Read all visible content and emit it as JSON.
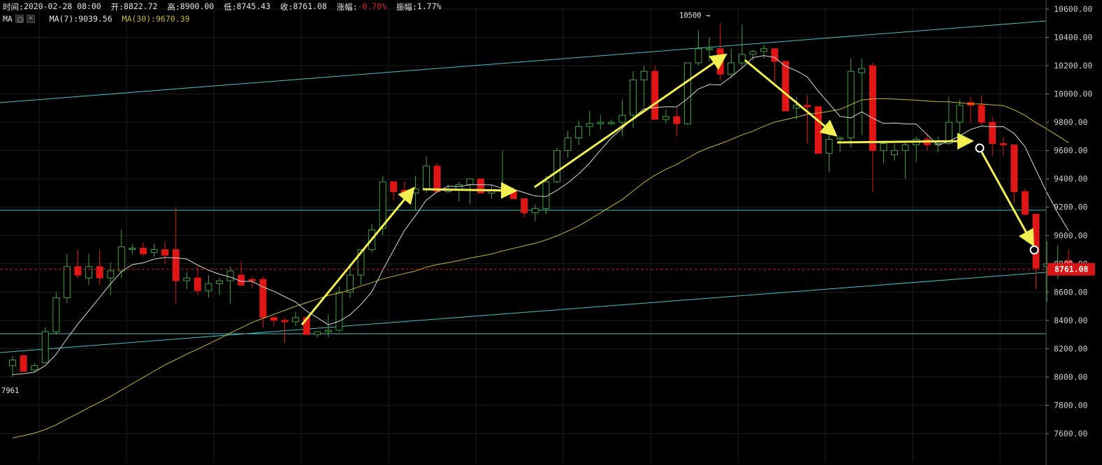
{
  "header": {
    "time_label": "时间:",
    "time_value": "2020-02-28 08:00",
    "open_label": "开:",
    "open_value": "8822.72",
    "high_label": "高:",
    "high_value": "8900.00",
    "low_label": "低:",
    "low_value": "8745.43",
    "close_label": "收:",
    "close_value": "8761.08",
    "change_label": "涨幅:",
    "change_value": "-0.70%",
    "amplitude_label": "振幅:",
    "amplitude_value": "1.77%"
  },
  "indicators": {
    "name": "MA",
    "ma7_label": "MA(7):",
    "ma7_value": "9039.56",
    "ma30_label": "MA(30):",
    "ma30_value": "9670.39"
  },
  "colors": {
    "up": "#3fa33f",
    "down": "#e01616",
    "ma7": "#d8d8d8",
    "ma30": "#c9b92a",
    "trendline": "#3fc4c4",
    "arrow": "#f2ef50",
    "grid": "#1d1d1d",
    "price_badge": "#d81414",
    "change_negative": "#e02424"
  },
  "chart_data": {
    "type": "candlestick",
    "y_ticks": [
      "10600.00",
      "10400.00",
      "10200.00",
      "10000.00",
      "9800.00",
      "9600.00",
      "9400.00",
      "9200.00",
      "9000.00",
      "8800.00",
      "8600.00",
      "8400.00",
      "8200.00",
      "8000.00",
      "7800.00",
      "7600.00"
    ],
    "ylim": [
      7500,
      10640
    ],
    "last_price_label": "8761.08",
    "last_price": 8761.08,
    "high_marker_label": "10500",
    "high_marker_value": 10500,
    "low_marker_label": "7961",
    "low_marker_value": 7961,
    "candles": [
      [
        8080,
        8150,
        8000,
        8120
      ],
      [
        8150,
        8160,
        8040,
        8040
      ],
      [
        8050,
        8100,
        8040,
        8080
      ],
      [
        8100,
        8350,
        8100,
        8320
      ],
      [
        8320,
        8600,
        8300,
        8560
      ],
      [
        8560,
        8870,
        8520,
        8780
      ],
      [
        8780,
        8900,
        8700,
        8720
      ],
      [
        8700,
        8870,
        8650,
        8780
      ],
      [
        8780,
        8900,
        8650,
        8700
      ],
      [
        8700,
        8810,
        8580,
        8750
      ],
      [
        8750,
        9040,
        8700,
        8920
      ],
      [
        8900,
        8940,
        8870,
        8910
      ],
      [
        8910,
        8950,
        8850,
        8870
      ],
      [
        8880,
        8940,
        8850,
        8900
      ],
      [
        8900,
        8960,
        8800,
        8860
      ],
      [
        8900,
        9200,
        8520,
        8680
      ],
      [
        8680,
        8740,
        8620,
        8700
      ],
      [
        8700,
        8780,
        8580,
        8610
      ],
      [
        8610,
        8720,
        8560,
        8660
      ],
      [
        8660,
        8700,
        8580,
        8680
      ],
      [
        8680,
        8780,
        8520,
        8750
      ],
      [
        8720,
        8820,
        8640,
        8650
      ],
      [
        8690,
        8710,
        8630,
        8680
      ],
      [
        8690,
        8710,
        8350,
        8420
      ],
      [
        8420,
        8430,
        8360,
        8400
      ],
      [
        8400,
        8420,
        8240,
        8390
      ],
      [
        8390,
        8460,
        8360,
        8420
      ],
      [
        8420,
        8420,
        8300,
        8300
      ],
      [
        8300,
        8320,
        8280,
        8320
      ],
      [
        8320,
        8440,
        8280,
        8330
      ],
      [
        8330,
        8640,
        8320,
        8600
      ],
      [
        8600,
        8780,
        8560,
        8720
      ],
      [
        8720,
        8850,
        8650,
        8900
      ],
      [
        8900,
        9080,
        8880,
        9040
      ],
      [
        9050,
        9420,
        9000,
        9380
      ],
      [
        9380,
        9380,
        9250,
        9310
      ],
      [
        9320,
        9380,
        9250,
        9300
      ],
      [
        9300,
        9420,
        9180,
        9330
      ],
      [
        9330,
        9560,
        9300,
        9490
      ],
      [
        9490,
        9510,
        9300,
        9310
      ],
      [
        9310,
        9360,
        9300,
        9320
      ],
      [
        9320,
        9380,
        9240,
        9360
      ],
      [
        9360,
        9400,
        9220,
        9400
      ],
      [
        9400,
        9400,
        9300,
        9300
      ],
      [
        9300,
        9360,
        9260,
        9320
      ],
      [
        9320,
        9600,
        9280,
        9320
      ],
      [
        9320,
        9340,
        9280,
        9260
      ],
      [
        9260,
        9250,
        9130,
        9160
      ],
      [
        9160,
        9220,
        9100,
        9190
      ],
      [
        9190,
        9420,
        9150,
        9380
      ],
      [
        9380,
        9620,
        9370,
        9600
      ],
      [
        9600,
        9740,
        9550,
        9690
      ],
      [
        9690,
        9810,
        9640,
        9770
      ],
      [
        9770,
        9880,
        9700,
        9790
      ],
      [
        9790,
        9850,
        9750,
        9800
      ],
      [
        9790,
        9820,
        9780,
        9800
      ],
      [
        9800,
        9960,
        9700,
        9850
      ],
      [
        9850,
        10160,
        9760,
        10100
      ],
      [
        10100,
        10200,
        9910,
        10160
      ],
      [
        10160,
        10200,
        9820,
        9820
      ],
      [
        9820,
        9890,
        9790,
        9840
      ],
      [
        9840,
        9900,
        9700,
        9790
      ],
      [
        9790,
        10150,
        9780,
        10220
      ],
      [
        10220,
        10450,
        10200,
        10320
      ],
      [
        10320,
        10400,
        10230,
        10320
      ],
      [
        10320,
        10500,
        10100,
        10140
      ],
      [
        10140,
        10320,
        10110,
        10220
      ],
      [
        10220,
        10490,
        10180,
        10280
      ],
      [
        10280,
        10310,
        10240,
        10300
      ],
      [
        10300,
        10350,
        10250,
        10320
      ],
      [
        10320,
        10320,
        10080,
        10230
      ],
      [
        10230,
        10160,
        9880,
        9880
      ],
      [
        9900,
        9980,
        9820,
        9920
      ],
      [
        9920,
        9990,
        9650,
        9910
      ],
      [
        9910,
        9910,
        9580,
        9580
      ],
      [
        9580,
        9720,
        9450,
        9680
      ],
      [
        9680,
        9700,
        9590,
        9690
      ],
      [
        9690,
        10250,
        9620,
        10160
      ],
      [
        10150,
        10250,
        9710,
        10180
      ],
      [
        10200,
        10220,
        9310,
        9600
      ],
      [
        9600,
        9640,
        9510,
        9650
      ],
      [
        9570,
        9650,
        9530,
        9600
      ],
      [
        9600,
        9660,
        9400,
        9640
      ],
      [
        9640,
        9700,
        9520,
        9680
      ],
      [
        9680,
        9720,
        9600,
        9640
      ],
      [
        9640,
        9700,
        9590,
        9650
      ],
      [
        9650,
        9980,
        9640,
        9800
      ],
      [
        9800,
        9960,
        9650,
        9920
      ],
      [
        9940,
        9980,
        9790,
        9920
      ],
      [
        9920,
        9990,
        9780,
        9800
      ],
      [
        9800,
        9840,
        9560,
        9650
      ],
      [
        9650,
        9700,
        9560,
        9640
      ],
      [
        9640,
        9640,
        9230,
        9310
      ],
      [
        9310,
        9330,
        9140,
        9150
      ],
      [
        9150,
        9000,
        8620,
        8770
      ],
      [
        8780,
        8960,
        8530,
        8800
      ],
      [
        8780,
        8930,
        8690,
        8800
      ],
      [
        8822.72,
        8900,
        8745.43,
        8761.08
      ]
    ]
  }
}
